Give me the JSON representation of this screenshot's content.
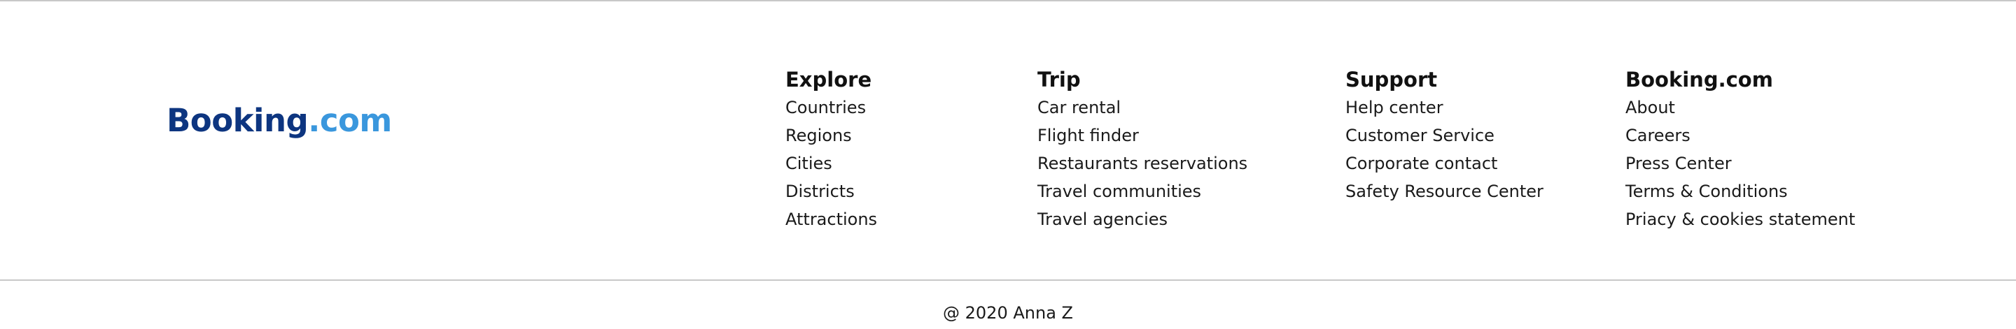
{
  "logo": {
    "brand": "Booking",
    "tld": ".com",
    "brand_color": "#0d3580",
    "tld_color": "#3a97dd"
  },
  "columns": [
    {
      "heading": "Explore",
      "links": [
        "Countries",
        "Regions",
        "Cities",
        "Districts",
        "Attractions"
      ]
    },
    {
      "heading": "Trip",
      "links": [
        "Car rental",
        "Flight finder",
        "Restaurants reservations",
        "Travel communities",
        "Travel agencies"
      ]
    },
    {
      "heading": "Support",
      "links": [
        "Help center",
        "Customer Service",
        "Corporate contact",
        "Safety Resource Center"
      ]
    },
    {
      "heading": "Booking.com",
      "links": [
        "About",
        "Careers",
        "Press Center",
        "Terms & Conditions",
        "Priacy & cookies statement"
      ]
    }
  ],
  "copyright": "@ 2020 Anna Z"
}
